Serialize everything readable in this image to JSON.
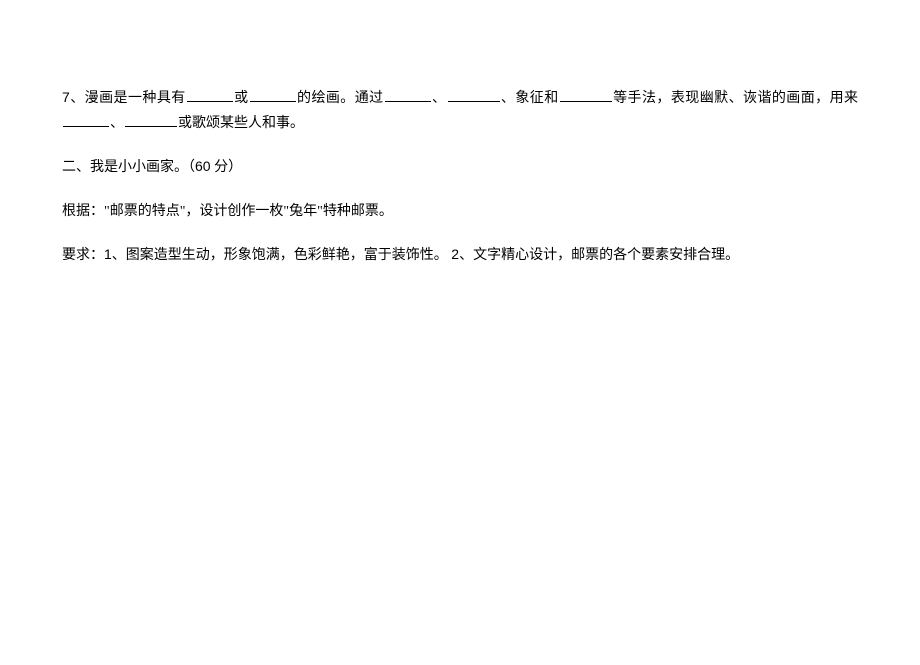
{
  "question7": {
    "number": "7",
    "part1": "、漫画是一种具有",
    "part2": "或",
    "part3": "的绘画。通过",
    "part4": "、",
    "part5": "、象征和",
    "part6": "等手法，表现幽默、诙谐的画面，用来",
    "part7": "、",
    "part8": "或歌颂某些人和事。"
  },
  "section2": {
    "title": "二、我是小小画家。（",
    "points": "60",
    "points_suffix": " 分）"
  },
  "instruction": {
    "text": "根据：\"邮票的特点\"，设计创作一枚\"兔年\"特种邮票。"
  },
  "requirements": {
    "prefix": "要求：",
    "item1_num": "1",
    "item1": "、图案造型生动，形象饱满，色彩鲜艳，富于装饰性。 ",
    "item2_num": "2",
    "item2": "、文字精心设计，邮票的各个要素安排合理。"
  }
}
